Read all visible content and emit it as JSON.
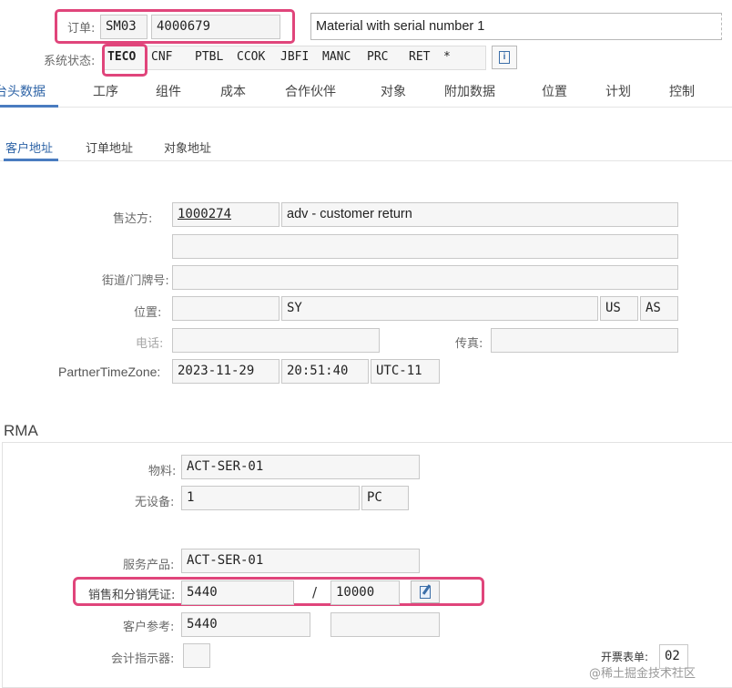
{
  "header": {
    "order_label": "订单:",
    "order_type": "SM03",
    "order_number": "4000679",
    "description": "Material with serial number 1",
    "status_label": "系统状态:",
    "statuses": [
      "TECO",
      "CNF",
      "PTBL",
      "CCOK",
      "JBFI",
      "MANC",
      "PRC",
      "RET",
      "*"
    ],
    "info_icon": "info-icon"
  },
  "tabs": [
    "台头数据",
    "工序",
    "组件",
    "成本",
    "合作伙伴",
    "对象",
    "附加数据",
    "位置",
    "计划",
    "控制"
  ],
  "subtabs": [
    "客户地址",
    "订单地址",
    "对象地址"
  ],
  "address": {
    "shipto_label": "售达方:",
    "shipto_id": "1000274",
    "shipto_name": "adv - customer return",
    "street_label": "街道/门牌号:",
    "location_label": "位置:",
    "city": "SY",
    "country": "US",
    "region": "AS",
    "phone_label": "电话:",
    "fax_label": "传真:",
    "tz_label": "PartnerTimeZone:",
    "date": "2023-11-29",
    "time": "20:51:40",
    "tz": "UTC-11"
  },
  "rma": {
    "title": "RMA",
    "material_label": "物料:",
    "material": "ACT-SER-01",
    "equipment_label": "无设备:",
    "quantity": "1",
    "unit": "PC",
    "service_label": "服务产品:",
    "service": "ACT-SER-01",
    "sales_label": "销售和分销凭证:",
    "sales_doc": "5440",
    "separator": "/",
    "sales_item": "10000",
    "edit_icon": "document-edit-icon",
    "customer_ref_label": "客户参考:",
    "customer_ref": "5440",
    "acct_label": "会计指示器:",
    "billing_form_label": "开票表单:",
    "billing_form": "02"
  },
  "watermark": "@稀土掘金技术社区"
}
